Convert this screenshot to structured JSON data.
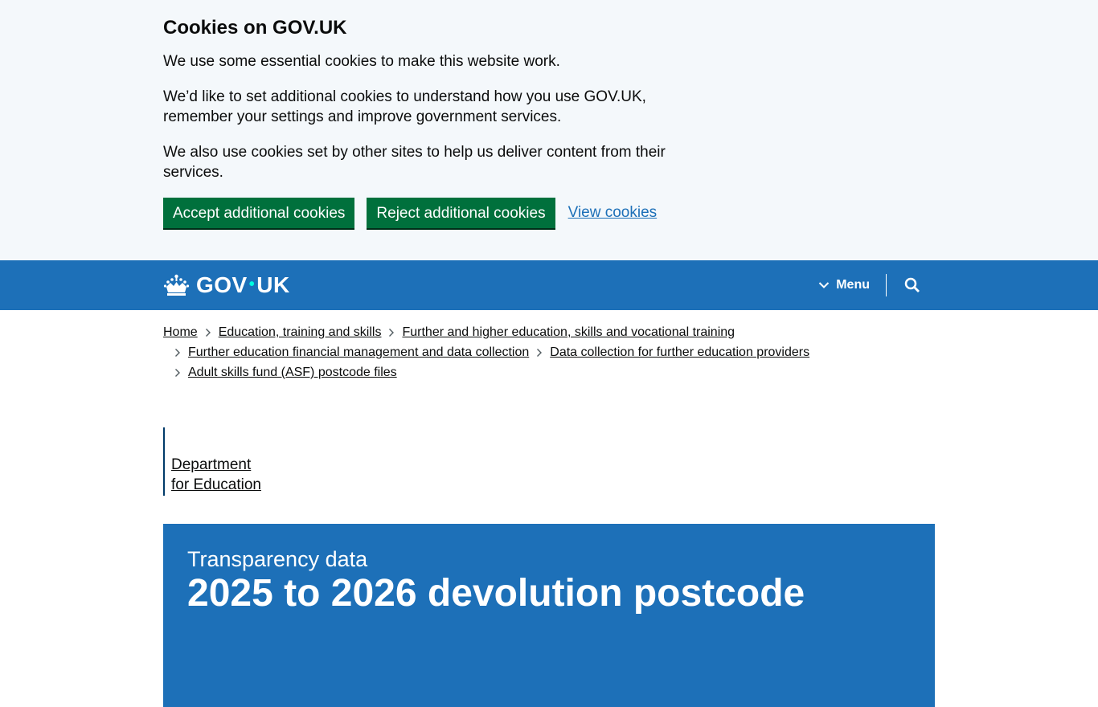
{
  "cookie_banner": {
    "title": "Cookies on GOV.UK",
    "paragraphs": [
      "We use some essential cookies to make this website work.",
      "We’d like to set additional cookies to understand how you use GOV.UK, remember your settings and improve government services.",
      "We also use cookies set by other sites to help us deliver content from their services."
    ],
    "accept_label": "Accept additional cookies",
    "reject_label": "Reject additional cookies",
    "view_label": "View cookies"
  },
  "header": {
    "logo_left": "GOV",
    "logo_dot": "•",
    "logo_right": "UK",
    "menu_label": "Menu",
    "crown_icon": "crown-icon",
    "search_icon": "search-icon",
    "brand_color": "#1d70b8"
  },
  "breadcrumbs": [
    "Home",
    "Education, training and skills",
    "Further and higher education, skills and vocational training",
    "Further education financial management and data collection",
    "Data collection for further education providers",
    "Adult skills fund (ASF) postcode files"
  ],
  "organisation": {
    "line1": "Department",
    "line2": "for Education"
  },
  "title_banner": {
    "doc_type": "Transparency data",
    "title": "2025 to 2026 devolution postcode"
  }
}
